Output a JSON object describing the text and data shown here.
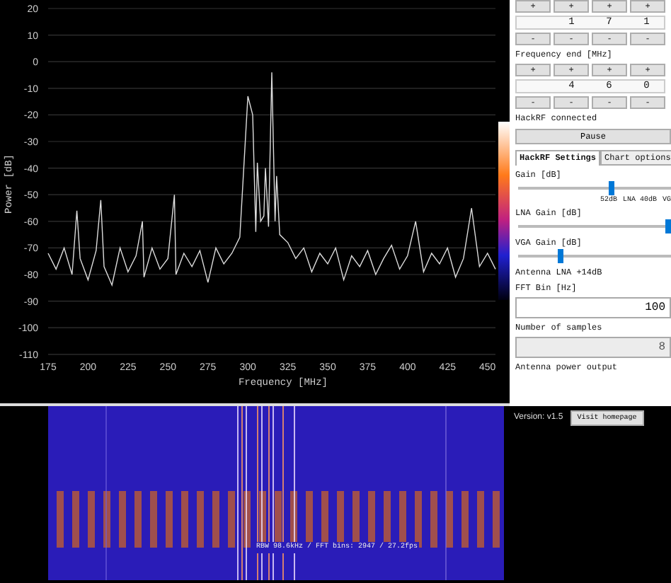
{
  "plot": {
    "chart_data": {
      "type": "line",
      "grid": true,
      "xlabel": "Frequency [MHz]",
      "ylabel": "Power [dB]",
      "xlim": [
        175,
        455
      ],
      "ylim": [
        -110,
        20
      ],
      "xticks": [
        175,
        200,
        225,
        250,
        275,
        300,
        325,
        350,
        375,
        400,
        425,
        450
      ],
      "yticks": [
        20,
        10,
        0,
        -10,
        -20,
        -30,
        -40,
        -50,
        -60,
        -70,
        -80,
        -90,
        -100,
        -110
      ],
      "x": [
        175,
        180,
        185,
        190,
        193,
        195,
        200,
        205,
        208,
        210,
        215,
        220,
        225,
        230,
        234,
        235,
        240,
        245,
        250,
        254,
        255,
        260,
        265,
        270,
        275,
        280,
        285,
        290,
        295,
        300,
        303,
        305,
        306,
        308,
        310,
        311,
        313,
        315,
        317,
        318,
        320,
        325,
        330,
        335,
        340,
        345,
        350,
        355,
        360,
        365,
        370,
        375,
        380,
        385,
        390,
        395,
        400,
        405,
        410,
        415,
        420,
        425,
        430,
        435,
        440,
        445,
        450,
        455
      ],
      "series": [
        {
          "color": "#dddddd",
          "values": [
            -72,
            -78,
            -70,
            -80,
            -56,
            -74,
            -82,
            -71,
            -52,
            -77,
            -84,
            -70,
            -79,
            -73,
            -60,
            -81,
            -70,
            -78,
            -74,
            -50,
            -80,
            -72,
            -77,
            -71,
            -83,
            -70,
            -76,
            -72,
            -66,
            -13,
            -20,
            -64,
            -38,
            -60,
            -58,
            -40,
            -62,
            -4,
            -60,
            -43,
            -65,
            -68,
            -74,
            -70,
            -79,
            -72,
            -76,
            -70,
            -82,
            -73,
            -77,
            -71,
            -80,
            -74,
            -69,
            -78,
            -73,
            -60,
            -79,
            -72,
            -76,
            -70,
            -81,
            -74,
            -55,
            -77,
            -72,
            -78
          ]
        }
      ]
    }
  },
  "waterfall": {
    "caption": "RBW 98.6kHz / FFT bins: 2947 / 27.2fps"
  },
  "freq_start": {
    "plus": [
      "+",
      "+",
      "+",
      "+"
    ],
    "digits": [
      "1",
      "7",
      "1"
    ],
    "minus": [
      "-",
      "-",
      "-",
      "-"
    ]
  },
  "freq_end": {
    "label": "Frequency end [MHz]",
    "plus": [
      "+",
      "+",
      "+",
      "+"
    ],
    "digits": [
      "4",
      "6",
      "0"
    ],
    "minus": [
      "-",
      "-",
      "-",
      "-"
    ]
  },
  "status": "HackRF connected",
  "pause_button": "Pause",
  "tabs": [
    {
      "label": "HackRF Settings",
      "selected": true
    },
    {
      "label": "Chart options",
      "selected": false
    }
  ],
  "settings": [
    {
      "kind": "slider",
      "label": "Gain [dB]",
      "level": 0.62,
      "ticks": [
        "52dB",
        "LNA 40dB",
        "VG"
      ]
    },
    {
      "kind": "slider",
      "label": "LNA Gain [dB]",
      "level": 1
    },
    {
      "kind": "slider",
      "label": "VGA Gain [dB]",
      "level": 0.27
    },
    {
      "kind": "note",
      "label": "Antenna LNA +14dB"
    },
    {
      "kind": "input",
      "label": "FFT Bin [Hz]",
      "value": "100",
      "disabled": false
    },
    {
      "kind": "input",
      "label": "Number of samples",
      "value": "8",
      "disabled": true
    },
    {
      "kind": "note",
      "label": "Antenna power output"
    }
  ],
  "footer": {
    "version": "Version: v1.5",
    "homepage_button": "Visit homepage"
  }
}
